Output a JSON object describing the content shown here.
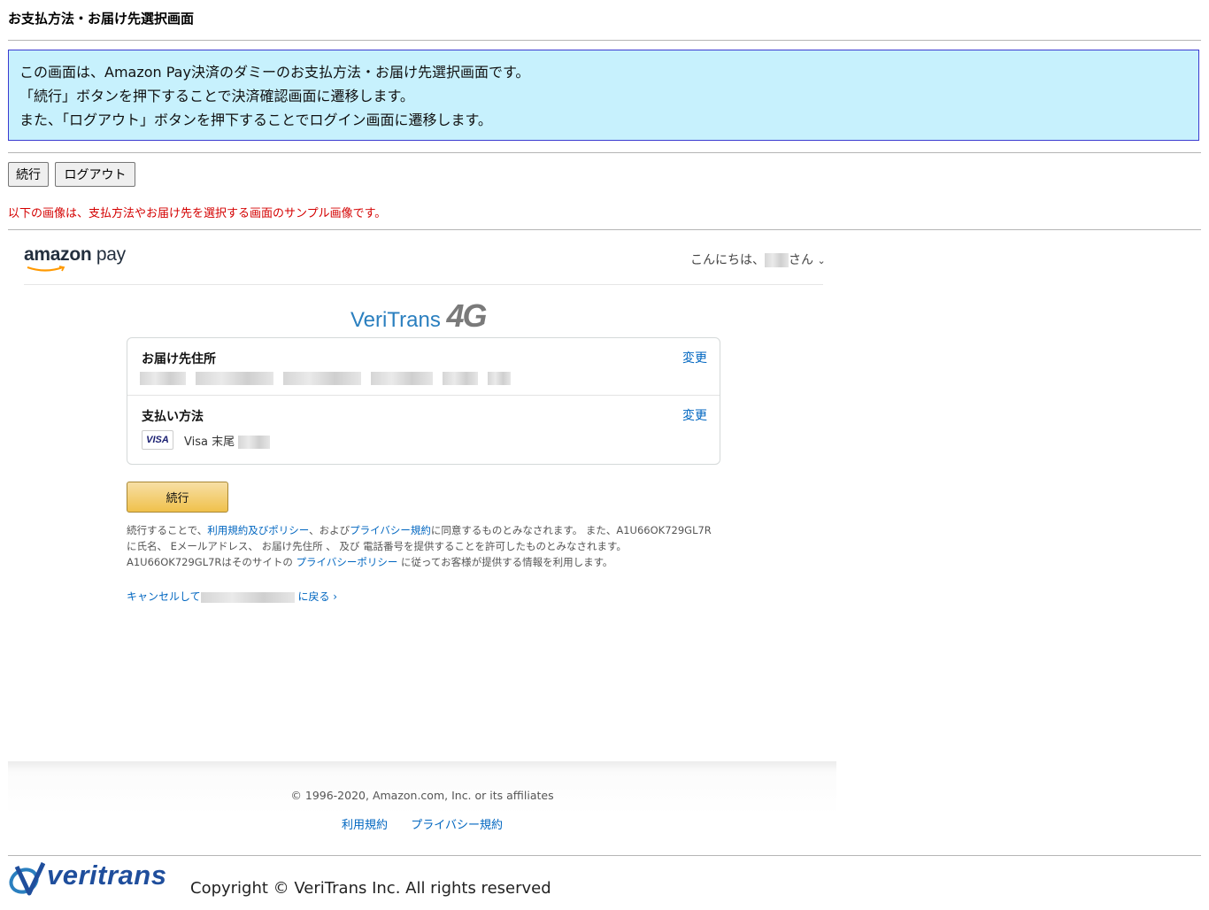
{
  "page": {
    "title": "お支払方法・お届け先選択画面",
    "info_lines": [
      "この画面は、Amazon Pay決済のダミーのお支払方法・お届け先選択画面です。",
      "「続行」ボタンを押下することで決済確認画面に遷移します。",
      "また、「ログアウト」ボタンを押下することでログイン画面に遷移します。"
    ],
    "buttons": {
      "continue": "続行",
      "logout": "ログアウト"
    },
    "notice": "以下の画像は、支払方法やお届け先を選択する画面のサンプル画像です。"
  },
  "sample": {
    "logo_bold": "amazon",
    "logo_light": " pay",
    "greeting": "こんにちは、",
    "greeting_suffix": "さん",
    "chevron": "⌄",
    "vt_logo_text": "VeriTrans",
    "vt_logo_4g": "4G",
    "address_label": "お届け先住所",
    "address_change": "変更",
    "payment_label": "支払い方法",
    "payment_change": "変更",
    "card_brand": "VISA",
    "card_text": "Visa 末尾",
    "continue_button": "続行",
    "terms": {
      "t1": "続行することで、",
      "link1": "利用規約及びポリシー",
      "t2": "、および",
      "link2": "プライバシー規約",
      "t3": "に同意するものとみなされます。 また、A1U66OK729GL7Rに氏名、 Eメールアドレス、 お届け先住所 、 及び 電話番号を提供することを許可したものとみなされます。 A1U66OK729GL7Rはそのサイトの ",
      "link3": "プライバシーポリシー",
      "t4": " に従ってお客様が提供する情報を利用します。"
    },
    "cancel_prefix": "キャンセルして",
    "cancel_suffix": " に戻る ›",
    "footer_copy": "© 1996-2020, Amazon.com, Inc. or its affiliates",
    "footer_links": [
      "利用規約",
      "プライバシー規約"
    ]
  },
  "footer": {
    "brand": "veritrans",
    "copyright": "Copyright © VeriTrans Inc. All rights reserved"
  },
  "colors": {
    "info_bg": "#c7f1fd",
    "info_border": "#3b3bd0",
    "notice": "#d40000",
    "link": "#0066c0",
    "gold": "#f0c14b"
  }
}
